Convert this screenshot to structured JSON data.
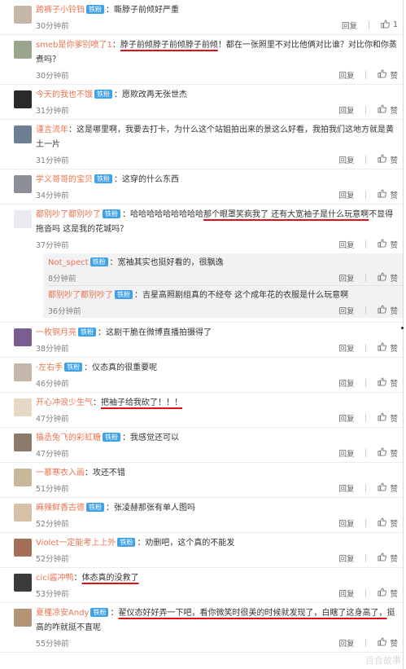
{
  "ui": {
    "reply_label": "回复",
    "like_label": "赞",
    "fan_badge": "铁粉",
    "watermark": "百合故事"
  },
  "comments": [
    {
      "user": "跨裤子小铃铛",
      "badge": "铁粉",
      "text": "：嘶脖子前倾好严重",
      "time": "30分钟前",
      "likes": "1"
    },
    {
      "user": "smeb是你爹别喷了1",
      "text_pre": "：",
      "text_ul": "脖子前倾脖子前倾脖子前倾",
      "text": "！都在一张照里不对比他俩对比谁？对比你和你蒸煮吗？",
      "time": "30分钟前"
    },
    {
      "user": "今天的我也不饿",
      "badge": "铁粉",
      "text": "：愿欺改再无张世杰",
      "time": "31分钟前"
    },
    {
      "user": "谨言流年",
      "text": "：这是哪里啊，我要去打卡，为什么这个站姐拍出来的景这么好看，我拍我们这地方就是黄土一片",
      "time": "31分钟前"
    },
    {
      "user": "学义哥哥的宝贝",
      "badge": "铁粉",
      "text": "：这穿的什么东西",
      "time": "34分钟前"
    },
    {
      "user": "都别吵了都别吵了",
      "badge": "铁粉",
      "text_pre": "：哈哈哈哈哈哈哈哈哈",
      "text_ul": "那个眼罩笑疯我了 还有大宽袖子是什么玩意啊",
      "text": "不显得拖沓吗 这是我的花城吗？",
      "time": "37分钟前",
      "replies": [
        {
          "user": "Not_spect",
          "badge": "铁粉",
          "text": "：宽袖其实也挺好看的，很飘逸",
          "time": "8分钟前"
        },
        {
          "user": "都别吵了都别吵了",
          "badge": "铁粉",
          "text": "：吉星高照剧组真的不经夸 这个成年花的衣服是什么玩意啊",
          "time": "36分钟前"
        }
      ]
    },
    {
      "user": "一枚铜月亮",
      "badge": "铁粉",
      "text": "：这剧干脆在微博直播拍摄得了",
      "time": "38分钟前"
    },
    {
      "user": "·左右手",
      "badge": "铁粉",
      "text": "：仪态真的很重要呢",
      "time": "46分钟前"
    },
    {
      "user": "开心冲浪少生气",
      "text_pre": "：",
      "text_ul": "把袖子给我砍了！！！",
      "text": "",
      "time": "47分钟前"
    },
    {
      "user": "猫丞兔飞的彩虹糖",
      "badge": "铁粉",
      "text": "：我感觉还可以",
      "time": "47分钟前"
    },
    {
      "user": "一慕寒衣入画",
      "text": "：攻还不错",
      "time": "51分钟前"
    },
    {
      "user": "麻辣鲜香古德",
      "badge": "铁粉",
      "text": "：张凌赫那张有单人图吗",
      "time": "52分钟前"
    },
    {
      "user": "Violet一定能考上上外",
      "badge": "铁粉",
      "text": "：劝删吧，这个真的不能发",
      "time": "52分钟前"
    },
    {
      "user": "cici酱冲鸭",
      "text_pre": "：",
      "text_ul": "体态真的没救了",
      "text": "",
      "time": "53分钟前"
    },
    {
      "user": "夏槿凉安Andy",
      "badge": "铁粉",
      "text_pre": "：",
      "text_ul": "翟仪态好好弄一下吧，看你微笑时很美的时候就发现了，白瞎了这身高了，",
      "text": "挺高的咋就挺不直呢",
      "time": "55分钟前"
    }
  ],
  "avatar_colors": [
    "#c7b7a8",
    "#9aa58e",
    "#2a2a2a",
    "#6e7f94",
    "#8c8f99",
    "#e9e9ef",
    "#7a5e8f",
    "#c4b7aa",
    "#e7d9c6",
    "#8c7a6a",
    "#c9b79a",
    "#d8c0a6",
    "#a36f58",
    "#3d3a3a",
    "#b49477",
    "#c8a3a3"
  ]
}
